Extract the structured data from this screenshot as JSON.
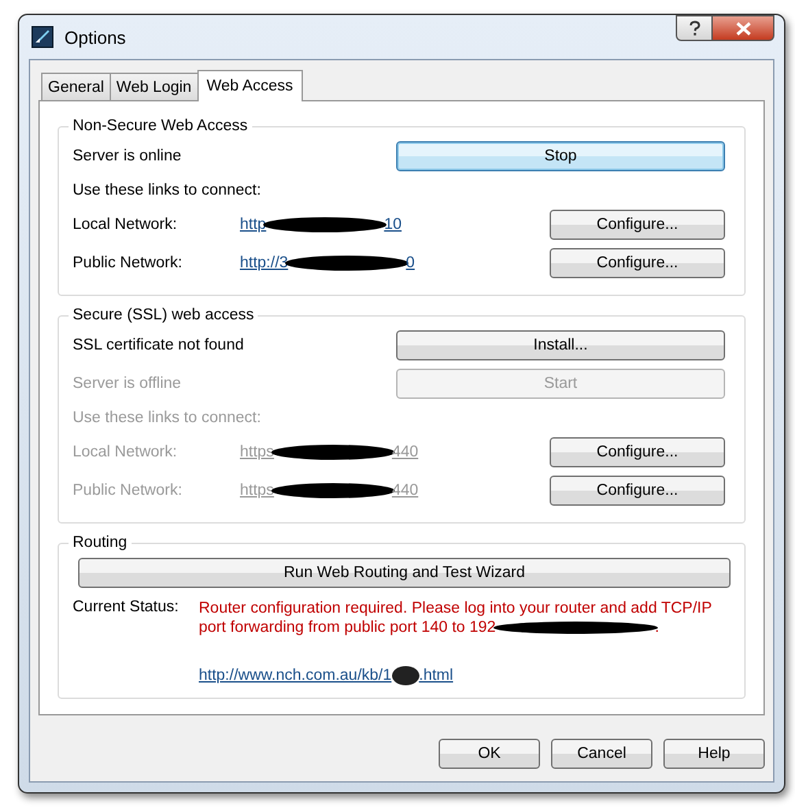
{
  "window": {
    "title": "Options"
  },
  "tabs": [
    {
      "label": "General",
      "selected": false
    },
    {
      "label": "Web Login",
      "selected": false
    },
    {
      "label": "Web Access",
      "selected": true
    }
  ],
  "sections": [
    {
      "title": "Non-Secure Web Access",
      "rows": [
        {
          "kind": "status",
          "text": "Server is online",
          "disabled": false,
          "button": {
            "label": "Stop",
            "default": true,
            "disabled": false
          }
        },
        {
          "kind": "note",
          "text": "Use these links to connect:",
          "disabled": false
        },
        {
          "kind": "link",
          "label": "Local Network:",
          "url_start": "http",
          "url_end": "10",
          "disabled": false,
          "button": "Configure..."
        },
        {
          "kind": "link",
          "label": "Public Network:",
          "url_start": "http://3",
          "url_end": "0",
          "disabled": false,
          "button": "Configure..."
        }
      ]
    },
    {
      "title": "Secure (SSL) web access",
      "rows": [
        {
          "kind": "status",
          "text": "SSL certificate not found",
          "disabled": false,
          "button": {
            "label": "Install...",
            "default": false,
            "disabled": false
          }
        },
        {
          "kind": "status",
          "text": "Server is offline",
          "disabled": true,
          "button": {
            "label": "Start",
            "default": false,
            "disabled": true
          }
        },
        {
          "kind": "note",
          "text": "Use these links to connect:",
          "disabled": true
        },
        {
          "kind": "link",
          "label": "Local Network:",
          "url_start": "https",
          "url_end": "440",
          "disabled": true,
          "button": "Configure..."
        },
        {
          "kind": "link",
          "label": "Public Network:",
          "url_start": "https",
          "url_end": "440",
          "disabled": true,
          "button": "Configure..."
        }
      ]
    },
    {
      "title": "Routing",
      "rows": [
        {
          "kind": "wide_button",
          "label": "Run Web Routing and Test Wizard"
        },
        {
          "kind": "message",
          "label": "Current Status:",
          "message_start": "Router configuration required. Please log into your router and add TCP/IP port forwarding from public port 140 to 192",
          "message_end": ".",
          "link_start": "http://www.nch.com.au/kb/1",
          "link_end": ".html"
        }
      ]
    }
  ],
  "buttons": [
    "OK",
    "Cancel",
    "Help"
  ]
}
